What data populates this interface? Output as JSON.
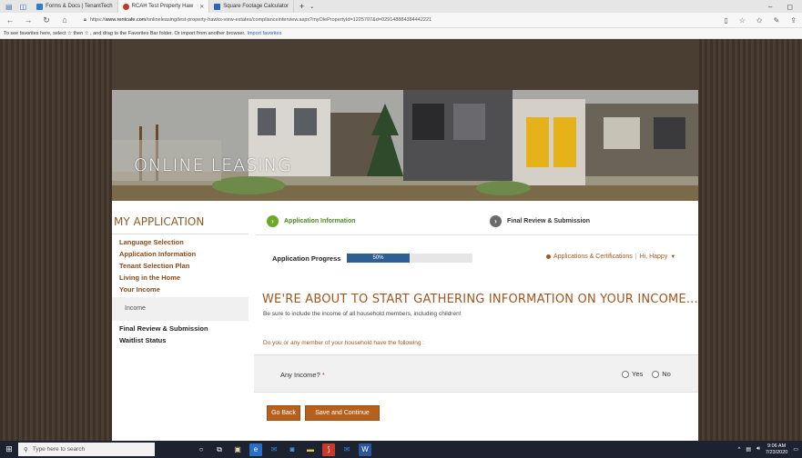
{
  "browser": {
    "tabs": [
      {
        "label": "Forms & Docs | TenantTech",
        "color": "#2e7ad1"
      },
      {
        "label": "RCAH Test Property Haw",
        "color": "#c0392b"
      },
      {
        "label": "Square Footage Calculator",
        "color": "#2e63b8"
      }
    ],
    "new_tab": "+",
    "url_prefix": "https://",
    "url_domain": "www.rentcafe.com",
    "url_path": "/onlineleasing/test-property-hawks-view-estates/complianceinterview.aspx?myOlePropertyId=1225707&d=029148884384442221",
    "favbar_text": "To see favorites here, select  ☆  then  ☆ , and drag to the Favorites Bar folder. Or import from another browser.",
    "favbar_link": "Import favorites"
  },
  "banner": {
    "title": "ONLINE LEASING"
  },
  "sidebar": {
    "title": "MY APPLICATION",
    "items": [
      {
        "label": "Language Selection"
      },
      {
        "label": "Application Information"
      },
      {
        "label": "Tenant Selection Plan"
      },
      {
        "label": "Living in the Home"
      },
      {
        "label": "Your Income"
      }
    ],
    "sub_item": "Income",
    "items_after": [
      {
        "label": "Final Review & Submission"
      },
      {
        "label": "Waitlist Status"
      }
    ]
  },
  "steps": {
    "step1": "Application Information",
    "step2": "Final Review & Submission"
  },
  "progress": {
    "label": "Application Progress",
    "value_text": "50%",
    "fraction": 0.5
  },
  "account": {
    "applications_link": "Applications & Certifications",
    "separator": "|",
    "greeting": "Hi, Happy"
  },
  "main": {
    "heading": "WE'RE ABOUT TO START GATHERING INFORMATION ON YOUR INCOME...",
    "subtext": "Be sure to include the income of all household members, including children!",
    "question": "Do you or any member of your household have the following :",
    "income_label": "Any Income?",
    "required_mark": "*",
    "option_yes": "Yes",
    "option_no": "No"
  },
  "buttons": {
    "back": "Go Back",
    "save": "Save and Continue"
  },
  "taskbar": {
    "search_placeholder": "Type here to search",
    "time": "9:06 AM",
    "date": "7/23/2020"
  }
}
